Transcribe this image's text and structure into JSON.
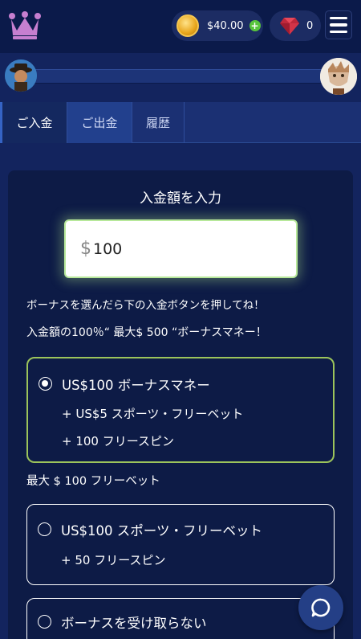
{
  "header": {
    "balance": "$40.00",
    "gems": "0"
  },
  "tabs": [
    {
      "label": "ご入金",
      "active": true
    },
    {
      "label": "ご出金",
      "active": false
    },
    {
      "label": "履歴",
      "active": false
    }
  ],
  "deposit": {
    "title": "入金額を入力",
    "currency_symbol": "$",
    "amount": "100",
    "hint": "ボーナスを選んだら下の入金ボタンを押してね！",
    "bonus_headline": "入金額の100％“ 最大$ 500 “ボーナスマネー！"
  },
  "options": [
    {
      "label": "US$100 ボーナスマネー",
      "perks": [
        "+ US$5 スポーツ・フリーベット",
        "+ 100 フリースピン"
      ],
      "selected": true
    },
    {
      "label": "US$100 スポーツ・フリーベット",
      "perks": [
        "+ 50 フリースピン"
      ],
      "selected": false
    },
    {
      "label": "ボーナスを受け取らない",
      "perks": [],
      "selected": false
    }
  ],
  "section_label": "最大 $ 100 フリーベット",
  "colors": {
    "background": "#13245e",
    "panel": "#0d1b46",
    "selected_border": "#9cc45b",
    "accent_green": "#58c43c"
  },
  "icons": {
    "logo": "crown-icon",
    "coin": "coin-icon",
    "gem": "gem-icon",
    "menu": "hamburger-menu-icon",
    "chat": "chat-icon"
  }
}
